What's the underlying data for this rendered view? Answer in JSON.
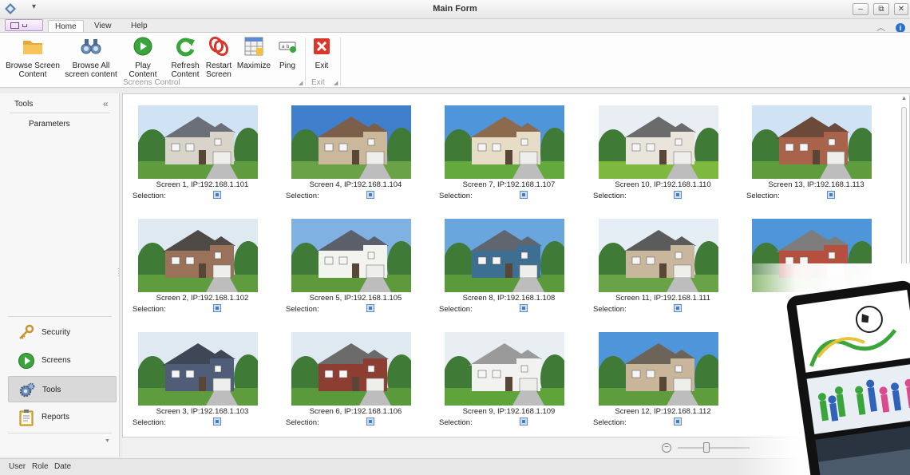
{
  "window": {
    "title": "Main Form",
    "minimize_glyph": "–",
    "restore_glyph": "⧉",
    "close_glyph": "✕"
  },
  "tabs": {
    "home": "Home",
    "view": "View",
    "help": "Help"
  },
  "ribbon": {
    "browse_screen_content": "Browse Screen\nContent",
    "browse_all_screen_content": "Browse All\nscreen content",
    "play_content": "Play Content",
    "refresh_content": "Refresh\nContent",
    "restart_screen": "Restart\nScreen",
    "maximize": "Maximize",
    "ping": "Ping",
    "exit": "Exit",
    "group_screens_control": "Screens Control",
    "group_exit": "Exit"
  },
  "sidebar": {
    "header": "Tools",
    "collapse_glyph": "«",
    "parameters": "Parameters",
    "nav": [
      {
        "label": "Security",
        "icon": "keys-icon",
        "active": false
      },
      {
        "label": "Screens",
        "icon": "play-circle-icon",
        "active": false
      },
      {
        "label": "Tools",
        "icon": "gears-icon",
        "active": true
      },
      {
        "label": "Reports",
        "icon": "clipboard-icon",
        "active": false
      }
    ],
    "more_glyph": "▼"
  },
  "screens": [
    {
      "label": "Screen 1, IP:192.168.1.101",
      "selection": "Selection:"
    },
    {
      "label": "Screen 4, IP:192.168.1.104",
      "selection": "Selection:"
    },
    {
      "label": "Screen 7, IP:192.168.1.107",
      "selection": "Selection:"
    },
    {
      "label": "Screen 10, IP:192.168.1.110",
      "selection": "Selection:"
    },
    {
      "label": "Screen 13, IP:192.168.1.113",
      "selection": "Selection:"
    },
    {
      "label": "Screen 2, IP:192.168.1.102",
      "selection": "Selection:"
    },
    {
      "label": "Screen 5, IP:192.168.1.105",
      "selection": "Selection:"
    },
    {
      "label": "Screen 8, IP:192.168.1.108",
      "selection": "Selection:"
    },
    {
      "label": "Screen 11, IP:192.168.1.111",
      "selection": "Selection:"
    },
    {
      "label": "",
      "selection": ""
    },
    {
      "label": "Screen 3, IP:192.168.1.103",
      "selection": "Selection:"
    },
    {
      "label": "Screen 6, IP:192.168.1.106",
      "selection": "Selection:"
    },
    {
      "label": "Screen 9, IP:192.168.1.109",
      "selection": "Selection:"
    },
    {
      "label": "Screen 12, IP:192.168.1.112",
      "selection": "Selection:"
    }
  ],
  "zoom": {
    "minus_glyph": "−",
    "level": 0.4
  },
  "statusbar": {
    "user": "User",
    "role": "Role",
    "date": "Date"
  },
  "colors": {
    "accent_blue": "#2b72c6",
    "play_green": "#3aa53a",
    "exit_red": "#d9372b"
  }
}
